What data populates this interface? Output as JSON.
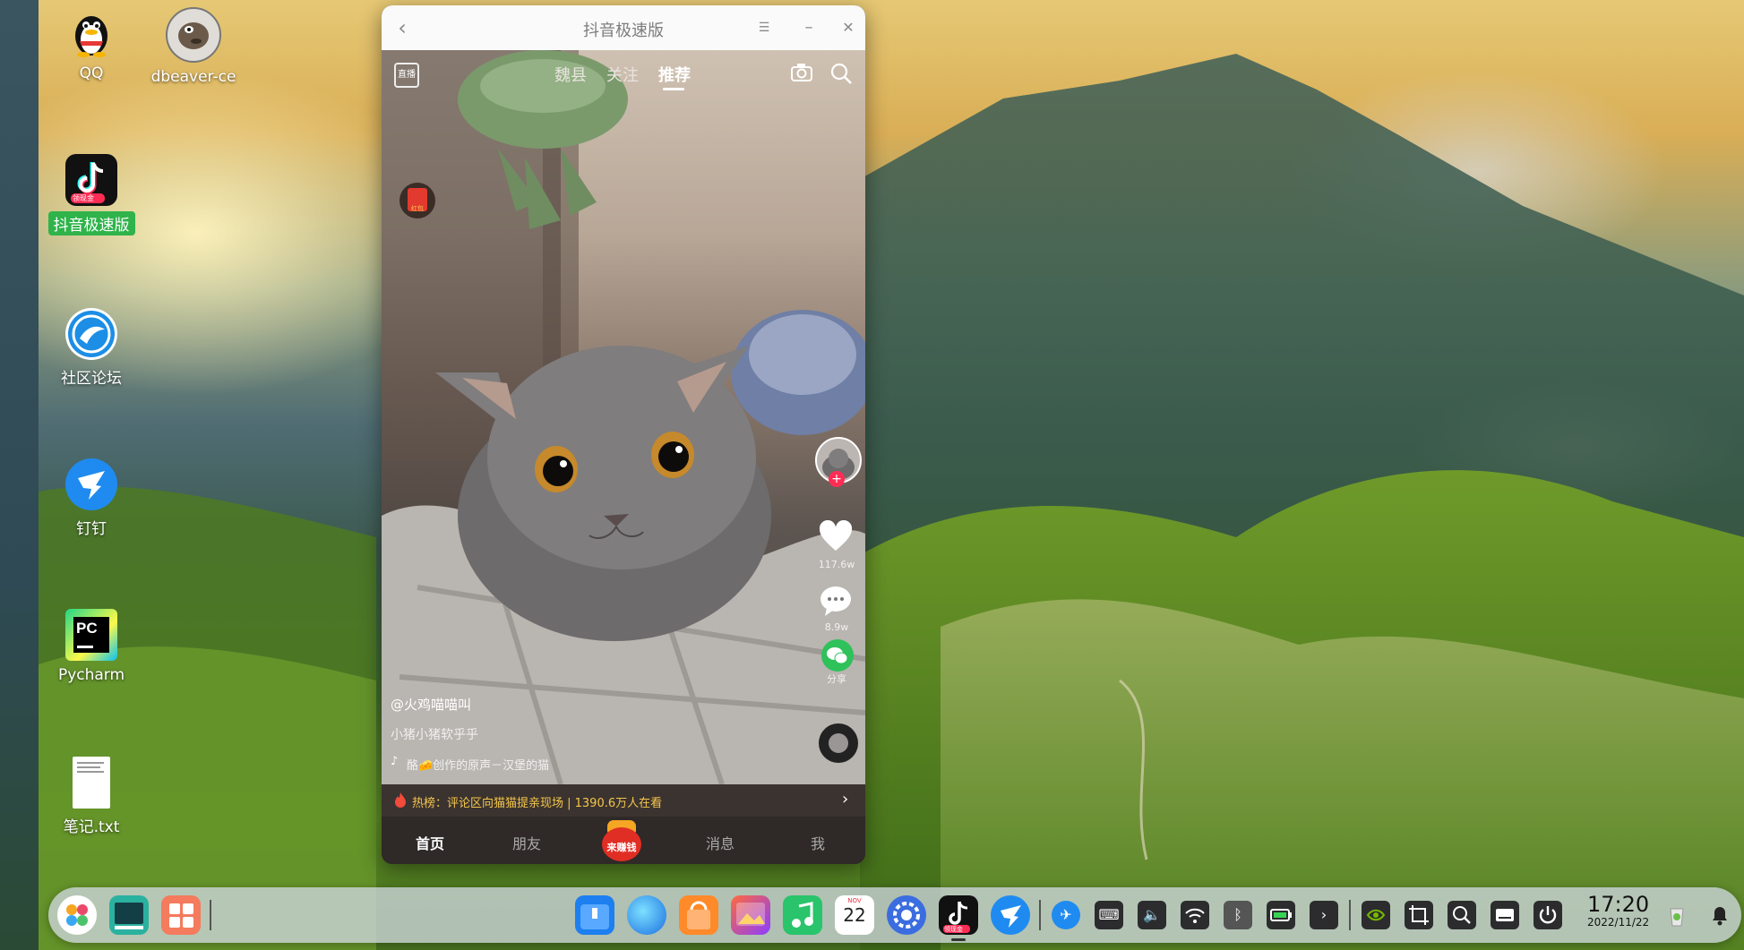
{
  "desktop": {
    "icons": [
      {
        "label": "QQ"
      },
      {
        "label": "dbeaver-ce"
      },
      {
        "label": "抖音极速版",
        "sublabel": "领现金"
      },
      {
        "label": "社区论坛"
      },
      {
        "label": "钉钉"
      },
      {
        "label": "Pycharm",
        "badge": "PC"
      },
      {
        "label": "笔记.txt"
      }
    ]
  },
  "window": {
    "title": "抖音极速版",
    "back_icon": "‹",
    "menu_icon": "☰",
    "minimize_icon": "–",
    "close_icon": "✕"
  },
  "app": {
    "live_label": "直播",
    "top_tabs": [
      "魏县",
      "关注",
      "推荐"
    ],
    "active_top_tab": "推荐",
    "red_packet_label": "红包",
    "likes": "117.6w",
    "comments": "8.9w",
    "share_label": "分享",
    "author": "@火鸡喵喵叫",
    "description": "小猪小猪软乎乎",
    "music": "酪🧀创作的原声－汉堡的猫",
    "hot_prefix": "热榜：评论区向猫猫提亲现场 | 1390.6万人在看",
    "bottom_tabs": [
      "首页",
      "朋友",
      "消息",
      "我"
    ],
    "earn_label": "来赚钱"
  },
  "dock": {
    "calendar_month": "NOV",
    "calendar_day": "22",
    "tiktok_badge": "领现金",
    "time": "17:20",
    "date": "2022/11/22"
  },
  "colors": {
    "accent_green": "#2fb34a",
    "hot_text": "#f5c64c",
    "tiktok_red": "#fe2c55"
  }
}
